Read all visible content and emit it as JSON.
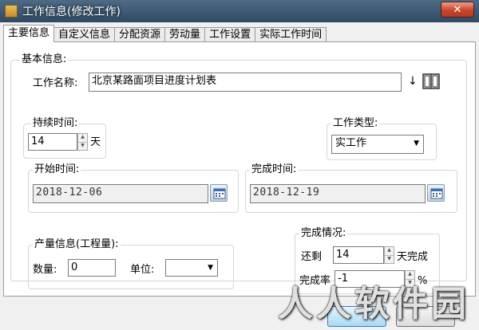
{
  "window": {
    "title": "工作信息(修改工作)",
    "close_label": "✕"
  },
  "tabs": [
    {
      "label": "主要信息",
      "active": true
    },
    {
      "label": "自定义信息",
      "active": false
    },
    {
      "label": "分配资源",
      "active": false
    },
    {
      "label": "劳动量",
      "active": false
    },
    {
      "label": "工作设置",
      "active": false
    },
    {
      "label": "实际工作时间",
      "active": false
    }
  ],
  "basic": {
    "group_label": "基本信息:",
    "name_label": "工作名称:",
    "name_value": "北京某路面项目进度计划表",
    "duration_label": "持续时间:",
    "duration_value": "14",
    "duration_unit": "天",
    "type_label": "工作类型:",
    "type_value": "实工作",
    "start_label": "开始时间:",
    "start_value": "2018-12-06",
    "finish_label": "完成时间:",
    "finish_value": "2018-12-19"
  },
  "output": {
    "group_label": "产量信息(工程量):",
    "qty_label": "数量:",
    "qty_value": "0",
    "unit_label": "单位:",
    "unit_value": ""
  },
  "completion": {
    "group_label": "完成情况:",
    "remain_prefix": "还剩",
    "remain_value": "14",
    "remain_suffix": "天完成",
    "rate_label": "完成率",
    "rate_value": "-1",
    "rate_unit": "%"
  },
  "watermark": "人人软件园",
  "icons": {
    "arrow": "↓",
    "spin_up": "▲",
    "spin_down": "▼",
    "dropdown": "▼"
  }
}
